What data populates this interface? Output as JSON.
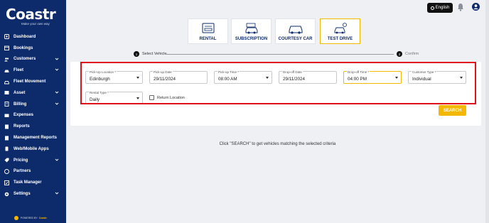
{
  "brand": {
    "name": "Coastr",
    "tagline": "Make your own way",
    "powered_prefix": "POWERED BY",
    "powered_brand": "Coastr"
  },
  "sidebar": {
    "items": [
      {
        "label": "Dashboard",
        "icon": "dashboard-icon",
        "expandable": false
      },
      {
        "label": "Bookings",
        "icon": "bookings-icon",
        "expandable": false
      },
      {
        "label": "Customers",
        "icon": "customers-icon",
        "expandable": true
      },
      {
        "label": "Fleet",
        "icon": "car-icon",
        "expandable": true
      },
      {
        "label": "Fleet Movement",
        "icon": "fleet-movement-icon",
        "expandable": false
      },
      {
        "label": "Asset",
        "icon": "asset-icon",
        "expandable": true
      },
      {
        "label": "Billing",
        "icon": "billing-icon",
        "expandable": true
      },
      {
        "label": "Expenses",
        "icon": "expenses-icon",
        "expandable": false
      },
      {
        "label": "Reports",
        "icon": "reports-icon",
        "expandable": false
      },
      {
        "label": "Management Reports",
        "icon": "management-reports-icon",
        "expandable": false
      },
      {
        "label": "Web/Mobile Apps",
        "icon": "apps-icon",
        "expandable": false
      },
      {
        "label": "Pricing",
        "icon": "pricing-icon",
        "expandable": true
      },
      {
        "label": "Partners",
        "icon": "partners-icon",
        "expandable": false
      },
      {
        "label": "Task Manager",
        "icon": "task-manager-icon",
        "expandable": false
      },
      {
        "label": "Settings",
        "icon": "gear-icon",
        "expandable": true
      }
    ]
  },
  "header": {
    "language": "English"
  },
  "tabs": [
    {
      "label": "RENTAL",
      "icon": "rental-icon",
      "active": false
    },
    {
      "label": "SUBSCRIPTION",
      "icon": "subscription-icon",
      "active": false
    },
    {
      "label": "COURTESY CAR",
      "icon": "courtesy-car-icon",
      "active": false
    },
    {
      "label": "TEST DRIVE",
      "icon": "test-drive-icon",
      "active": true
    }
  ],
  "stepper": {
    "steps": [
      {
        "num": "1",
        "label": "Select Vehicle",
        "active": true
      },
      {
        "num": "2",
        "label": "Confirm",
        "active": false
      }
    ]
  },
  "form": {
    "pickup_location": {
      "label": "Pick-Up Location *",
      "value": "Edinburgh"
    },
    "pickup_date": {
      "label": "Pick-up Date",
      "value": "29/11/2024"
    },
    "pickup_time": {
      "label": "Pick-up Time *",
      "value": "08:00 AM"
    },
    "dropoff_date": {
      "label": "Drop-off Date",
      "value": "29/11/2024"
    },
    "dropoff_time": {
      "label": "Drop-off Time *",
      "value": "04:00 PM"
    },
    "customer_type": {
      "label": "Customer Type *",
      "value": "Individual"
    },
    "rental_type": {
      "label": "Rental Type *",
      "value": "Daily"
    },
    "return_location": {
      "label": "Return Location",
      "checked": false
    }
  },
  "search_button": "SEARCH",
  "hint": "Click \"SEARCH\" to get vehicles matching the selected criteria",
  "colors": {
    "sidebar": "#0d2a6b",
    "accent": "#f5b800",
    "highlight": "#e0101e"
  }
}
